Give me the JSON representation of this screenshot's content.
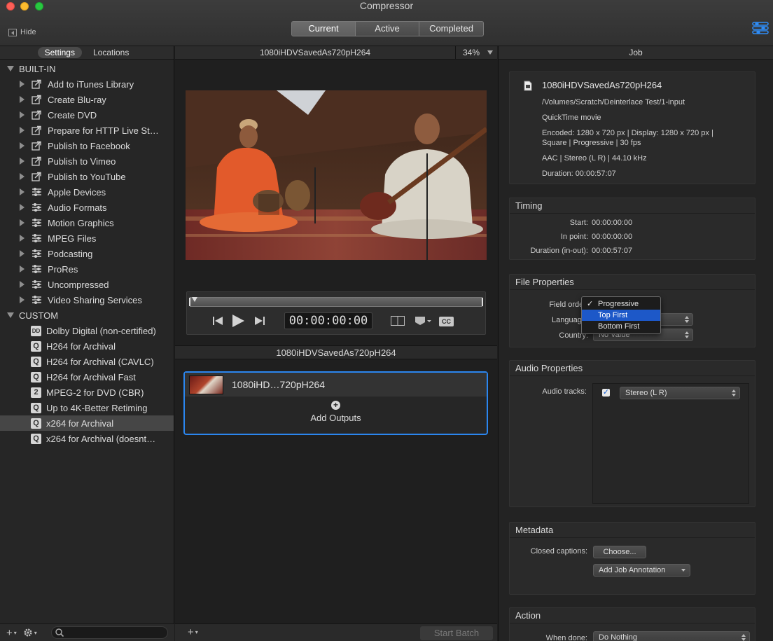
{
  "window": {
    "title": "Compressor",
    "hide_label": "Hide",
    "tabs": [
      {
        "label": "Current",
        "selected": true
      },
      {
        "label": "Active",
        "selected": false
      },
      {
        "label": "Completed",
        "selected": false
      }
    ]
  },
  "sidebar": {
    "tabs": [
      {
        "label": "Settings",
        "selected": true
      },
      {
        "label": "Locations",
        "selected": false
      }
    ],
    "builtin_label": "BUILT-IN",
    "builtin_items": [
      {
        "label": "Add to iTunes Library",
        "icon": "share-icon"
      },
      {
        "label": "Create Blu-ray",
        "icon": "share-icon"
      },
      {
        "label": "Create DVD",
        "icon": "share-icon"
      },
      {
        "label": "Prepare for HTTP Live St…",
        "icon": "share-icon"
      },
      {
        "label": "Publish to Facebook",
        "icon": "share-icon"
      },
      {
        "label": "Publish to Vimeo",
        "icon": "share-icon"
      },
      {
        "label": "Publish to YouTube",
        "icon": "share-icon"
      },
      {
        "label": "Apple Devices",
        "icon": "settings-group-icon"
      },
      {
        "label": "Audio Formats",
        "icon": "settings-group-icon"
      },
      {
        "label": "Motion Graphics",
        "icon": "settings-group-icon"
      },
      {
        "label": "MPEG Files",
        "icon": "settings-group-icon"
      },
      {
        "label": "Podcasting",
        "icon": "settings-group-icon"
      },
      {
        "label": "ProRes",
        "icon": "settings-group-icon"
      },
      {
        "label": "Uncompressed",
        "icon": "settings-group-icon"
      },
      {
        "label": "Video Sharing Services",
        "icon": "settings-group-icon"
      }
    ],
    "custom_label": "CUSTOM",
    "custom_items": [
      {
        "label": "Dolby Digital (non-certified)",
        "badge": "DD"
      },
      {
        "label": "H264 for Archival",
        "badge": "Q"
      },
      {
        "label": "H264 for Archival (CAVLC)",
        "badge": "Q"
      },
      {
        "label": "H264 for Archival Fast",
        "badge": "Q"
      },
      {
        "label": "MPEG-2 for DVD (CBR)",
        "badge": "2"
      },
      {
        "label": "Up to 4K-Better Retiming",
        "badge": "Q"
      },
      {
        "label": "x264 for Archival",
        "badge": "Q",
        "selected": true
      },
      {
        "label": "x264 for Archival (doesnt…",
        "badge": "Q"
      }
    ]
  },
  "preview": {
    "title": "1080iHDVSavedAs720pH264",
    "zoom": "34%",
    "timecode": "00:00:00:00",
    "cc_label": "CC"
  },
  "batch": {
    "title": "1080iHDVSavedAs720pH264",
    "job_name": "1080iHD…720pH264",
    "add_outputs": "Add Outputs",
    "start_batch": "Start Batch"
  },
  "inspector": {
    "title": "Job",
    "source": {
      "name": "1080iHDVSavedAs720pH264",
      "path": "/Volumes/Scratch/Deinterlace Test/1-input",
      "kind": "QuickTime movie",
      "encoded_line1": "Encoded: 1280 x 720 px | Display: 1280 x 720 px |",
      "encoded_line2": "Square | Progressive | 30 fps",
      "audio": "AAC | Stereo (L R) | 44.10 kHz",
      "duration": "Duration: 00:00:57:07"
    },
    "timing": {
      "title": "Timing",
      "start_label": "Start:",
      "start": "00:00:00:00",
      "in_label": "In point:",
      "in": "00:00:00:00",
      "dur_label": "Duration (in-out):",
      "dur": "00:00:57:07"
    },
    "file_props": {
      "title": "File Properties",
      "field_order_label": "Field order:",
      "language_label": "Language:",
      "country_label": "Country:",
      "country_value": "No Value",
      "menu_options": [
        "Progressive",
        "Top First",
        "Bottom First"
      ],
      "menu_checked": "Progressive",
      "menu_highlighted": "Top First"
    },
    "audio_props": {
      "title": "Audio Properties",
      "tracks_label": "Audio tracks:",
      "track_value": "Stereo (L R)"
    },
    "metadata": {
      "title": "Metadata",
      "cc_label": "Closed captions:",
      "choose": "Choose...",
      "annotation": "Add Job Annotation"
    },
    "action": {
      "title": "Action",
      "when_done_label": "When done:",
      "when_done_value": "Do Nothing"
    }
  },
  "colors": {
    "accent": "#2b86ef",
    "menu_highlight": "#1d58c8"
  }
}
